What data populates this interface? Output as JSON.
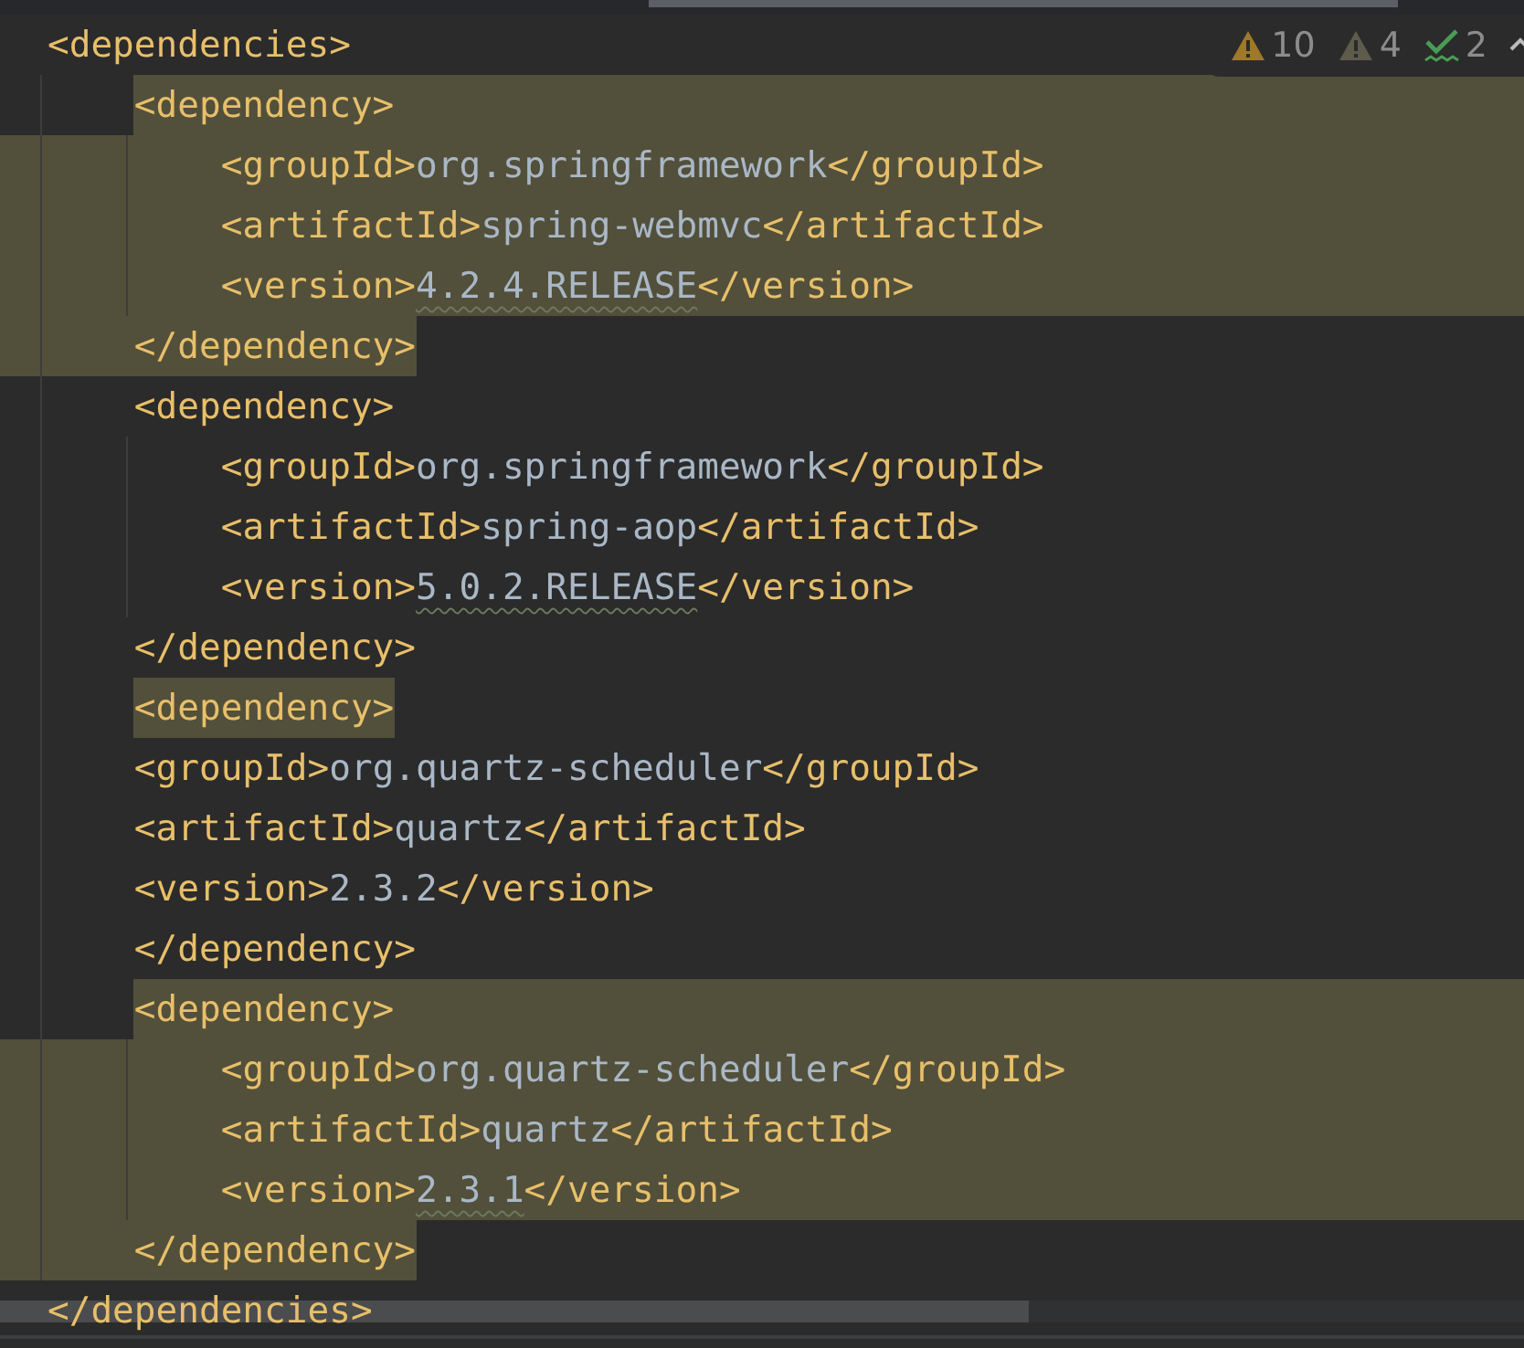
{
  "inspection_widget": {
    "items": [
      {
        "kind": "warning",
        "count": "10"
      },
      {
        "kind": "weak-warning",
        "count": "4"
      },
      {
        "kind": "typo",
        "count": "2"
      }
    ]
  },
  "editor": {
    "lines": [
      {
        "kind": "plain",
        "segments": [
          {
            "kind": "tag",
            "text": "<dependencies>"
          }
        ]
      },
      {
        "kind": "block-start",
        "segments": [
          {
            "kind": "tag",
            "text": "    <dependency>"
          }
        ]
      },
      {
        "kind": "block-middle",
        "segments": [
          {
            "kind": "tag",
            "text": "        <groupId>"
          },
          {
            "kind": "value",
            "text": "org.springframework"
          },
          {
            "kind": "tag",
            "text": "</groupId>"
          }
        ]
      },
      {
        "kind": "block-middle",
        "segments": [
          {
            "kind": "tag",
            "text": "        <artifactId>"
          },
          {
            "kind": "value",
            "text": "spring-webmvc"
          },
          {
            "kind": "tag",
            "text": "</artifactId>"
          }
        ]
      },
      {
        "kind": "block-middle",
        "segments": [
          {
            "kind": "tag",
            "text": "        <version>"
          },
          {
            "kind": "value",
            "text": "4.2.4.RELEASE",
            "typo": true
          },
          {
            "kind": "tag",
            "text": "</version>"
          }
        ]
      },
      {
        "kind": "block-end",
        "segments": [
          {
            "kind": "tag",
            "text": "    </dependency>"
          }
        ]
      },
      {
        "kind": "plain",
        "segments": [
          {
            "kind": "tag",
            "text": "    <dependency>"
          }
        ]
      },
      {
        "kind": "plain",
        "segments": [
          {
            "kind": "tag",
            "text": "        <groupId>"
          },
          {
            "kind": "value",
            "text": "org.springframework"
          },
          {
            "kind": "tag",
            "text": "</groupId>"
          }
        ]
      },
      {
        "kind": "plain",
        "segments": [
          {
            "kind": "tag",
            "text": "        <artifactId>"
          },
          {
            "kind": "value",
            "text": "spring-aop"
          },
          {
            "kind": "tag",
            "text": "</artifactId>"
          }
        ]
      },
      {
        "kind": "plain",
        "segments": [
          {
            "kind": "tag",
            "text": "        <version>"
          },
          {
            "kind": "value",
            "text": "5.0.2.RELEASE",
            "typo": true
          },
          {
            "kind": "tag",
            "text": "</version>"
          }
        ]
      },
      {
        "kind": "plain",
        "segments": [
          {
            "kind": "tag",
            "text": "    </dependency>"
          }
        ]
      },
      {
        "kind": "word-match",
        "segments": [
          {
            "kind": "tag",
            "text": "    <dependency>"
          }
        ]
      },
      {
        "kind": "plain",
        "segments": [
          {
            "kind": "tag",
            "text": "    <groupId>"
          },
          {
            "kind": "value",
            "text": "org.quartz-scheduler"
          },
          {
            "kind": "tag",
            "text": "</groupId>"
          }
        ]
      },
      {
        "kind": "plain",
        "segments": [
          {
            "kind": "tag",
            "text": "    <artifactId>"
          },
          {
            "kind": "value",
            "text": "quartz"
          },
          {
            "kind": "tag",
            "text": "</artifactId>"
          }
        ]
      },
      {
        "kind": "plain",
        "segments": [
          {
            "kind": "tag",
            "text": "    <version>"
          },
          {
            "kind": "value",
            "text": "2.3.2"
          },
          {
            "kind": "tag",
            "text": "</version>"
          }
        ]
      },
      {
        "kind": "plain",
        "segments": [
          {
            "kind": "tag",
            "text": "    </dependency>"
          }
        ]
      },
      {
        "kind": "block-start",
        "segments": [
          {
            "kind": "tag",
            "text": "    <dependency>"
          }
        ]
      },
      {
        "kind": "block-middle",
        "segments": [
          {
            "kind": "tag",
            "text": "        <groupId>"
          },
          {
            "kind": "value",
            "text": "org.quartz-scheduler"
          },
          {
            "kind": "tag",
            "text": "</groupId>"
          }
        ]
      },
      {
        "kind": "block-middle",
        "segments": [
          {
            "kind": "tag",
            "text": "        <artifactId>"
          },
          {
            "kind": "value",
            "text": "quartz"
          },
          {
            "kind": "tag",
            "text": "</artifactId>"
          }
        ]
      },
      {
        "kind": "block-middle",
        "segments": [
          {
            "kind": "tag",
            "text": "        <version>"
          },
          {
            "kind": "value",
            "text": "2.3.1",
            "typo": true
          },
          {
            "kind": "tag",
            "text": "</version>"
          }
        ]
      },
      {
        "kind": "block-end",
        "segments": [
          {
            "kind": "tag",
            "text": "    </dependency>"
          }
        ]
      },
      {
        "kind": "plain",
        "segments": [
          {
            "kind": "tag",
            "text": "</dependencies>"
          }
        ]
      }
    ]
  }
}
